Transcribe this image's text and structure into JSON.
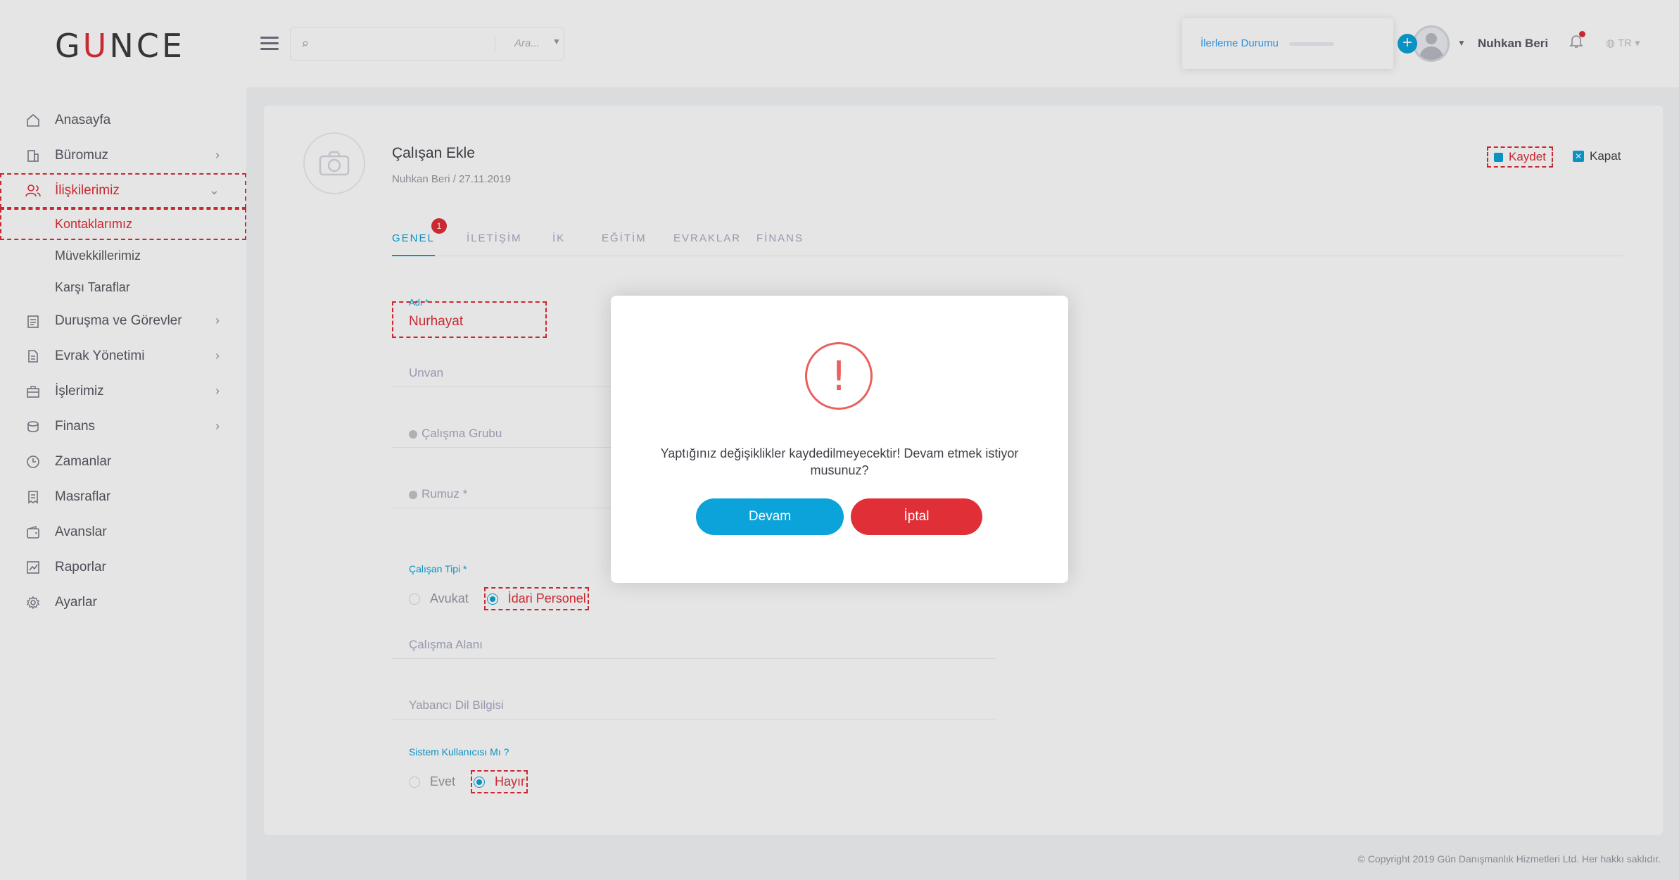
{
  "app": {
    "logo": "GUNCE"
  },
  "sidebar": {
    "items": [
      {
        "label": "Anasayfa",
        "icon": "home-icon",
        "has_children": false
      },
      {
        "label": "Büromuz",
        "icon": "building-icon",
        "has_children": true
      },
      {
        "label": "İlişkilerimiz",
        "icon": "users-icon",
        "has_children": true,
        "active": true,
        "children": [
          {
            "label": "Kontaklarımız",
            "active": true
          },
          {
            "label": "Müvekkillerimiz"
          },
          {
            "label": "Karşı Taraflar"
          }
        ]
      },
      {
        "label": "Duruşma ve Görevler",
        "icon": "clipboard-icon",
        "has_children": true
      },
      {
        "label": "Evrak Yönetimi",
        "icon": "document-icon",
        "has_children": true
      },
      {
        "label": "İşlerimiz",
        "icon": "briefcase-icon",
        "has_children": true
      },
      {
        "label": "Finans",
        "icon": "coins-icon",
        "has_children": true
      },
      {
        "label": "Zamanlar",
        "icon": "clock-icon",
        "has_children": false
      },
      {
        "label": "Masraflar",
        "icon": "receipt-icon",
        "has_children": false
      },
      {
        "label": "Avanslar",
        "icon": "wallet-icon",
        "has_children": false
      },
      {
        "label": "Raporlar",
        "icon": "chart-icon",
        "has_children": false
      },
      {
        "label": "Ayarlar",
        "icon": "gear-icon",
        "has_children": false
      }
    ]
  },
  "topbar": {
    "search_placeholder": "Ara...",
    "progress_label": "İlerleme Durumu",
    "progress_value": 0,
    "user_name": "Nuhkan Beri",
    "language": "TR"
  },
  "page": {
    "title": "Çalışan Ekle",
    "subtitle": "Nuhkan Beri / 27.11.2019",
    "save_label": "Kaydet",
    "close_label": "Kapat",
    "tabs": [
      {
        "label": "GENEL",
        "active": true,
        "badge": "1"
      },
      {
        "label": "İLETİŞİM"
      },
      {
        "label": "İK"
      },
      {
        "label": "EĞİTİM"
      },
      {
        "label": "EVRAKLAR"
      },
      {
        "label": "FİNANS"
      }
    ],
    "fields": {
      "name_label": "Adı *",
      "name_value": "Nurhayat",
      "title_placeholder": "Unvan",
      "group_placeholder": "Çalışma Grubu",
      "code_placeholder": "Rumuz *",
      "employee_type_label": "Çalışan Tipi *",
      "employee_type_options": [
        "Avukat",
        "İdari Personel"
      ],
      "employee_type_selected": "İdari Personel",
      "work_area_placeholder": "Çalışma Alanı",
      "language_placeholder": "Yabancı Dil Bilgisi",
      "system_user_label": "Sistem Kullanıcısı Mı ?",
      "system_user_options": [
        "Evet",
        "Hayır"
      ],
      "system_user_selected": "Hayır"
    }
  },
  "modal": {
    "message": "Yaptığınız değişiklikler kaydedilmeyecektir! Devam etmek istiyor musunuz?",
    "confirm_label": "Devam",
    "cancel_label": "İptal"
  },
  "footer": {
    "copyright": "© Copyright 2019 Gün Danışmanlık Hizmetleri Ltd. Her hakkı saklıdır."
  },
  "colors": {
    "brand_red": "#e02f37",
    "accent_blue": "#0ba3d9",
    "warning": "#e9605f"
  }
}
